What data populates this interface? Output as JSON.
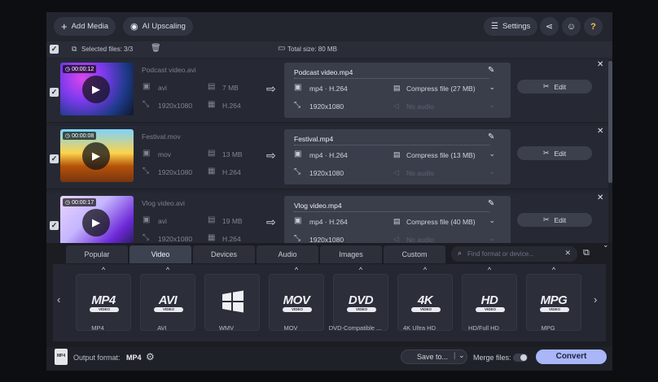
{
  "topbar": {
    "add_media": "Add Media",
    "ai_upscaling": "AI Upscaling",
    "settings": "Settings"
  },
  "selection": {
    "selected_files": "Selected files: 3/3",
    "total_size": "Total size: 80 MB"
  },
  "files": [
    {
      "duration": "00:00:12",
      "source_name": "Podcast video.avi",
      "src_format": "avi",
      "src_size": "7 MB",
      "src_resolution": "1920x1080",
      "src_codec": "H.264",
      "output_name": "Podcast video.mp4",
      "out_format": "mp4 · H.264",
      "out_resolution": "1920x1080",
      "compress": "Compress file (27 MB)",
      "audio": "No audio",
      "edit": "Edit"
    },
    {
      "duration": "00:00:08",
      "source_name": "Festival.mov",
      "src_format": "mov",
      "src_size": "13 MB",
      "src_resolution": "1920x1080",
      "src_codec": "H.264",
      "output_name": "Festival.mp4",
      "out_format": "mp4 · H.264",
      "out_resolution": "1920x1080",
      "compress": "Compress file (13 MB)",
      "audio": "No audio",
      "edit": "Edit"
    },
    {
      "duration": "00:00:17",
      "source_name": "Vlog video.avi",
      "src_format": "avi",
      "src_size": "19 MB",
      "src_resolution": "1920x1080",
      "src_codec": "H.264",
      "output_name": "Vlog video.mp4",
      "out_format": "mp4 · H.264",
      "out_resolution": "1920x1080",
      "compress": "Compress file (40 MB)",
      "audio": "No audio",
      "edit": "Edit"
    }
  ],
  "format_tabs": [
    "Popular",
    "Video",
    "Devices",
    "Audio",
    "Images",
    "Custom"
  ],
  "active_tab": "Video",
  "search_placeholder": "Find format or device...",
  "formats": [
    {
      "logo": "MP4",
      "sub": "VIDEO",
      "label": "MP4"
    },
    {
      "logo": "AVI",
      "sub": "VIDEO",
      "label": "AVI"
    },
    {
      "logo": "",
      "sub": "",
      "label": "WMV"
    },
    {
      "logo": "MOV",
      "sub": "VIDEO",
      "label": "MOV"
    },
    {
      "logo": "DVD",
      "sub": "VIDEO",
      "label": "DVD-Compatible ..."
    },
    {
      "logo": "4K",
      "sub": "VIDEO",
      "label": "4K Ultra HD"
    },
    {
      "logo": "HD",
      "sub": "VIDEO",
      "label": "HD/Full HD"
    },
    {
      "logo": "MPG",
      "sub": "VIDEO",
      "label": "MPG"
    }
  ],
  "bottom": {
    "format_icon_text": "MP4",
    "output_format_label": "Output format:",
    "output_format_value": "MP4",
    "save_to": "Save to...",
    "merge_files": "Merge files:",
    "convert": "Convert"
  }
}
